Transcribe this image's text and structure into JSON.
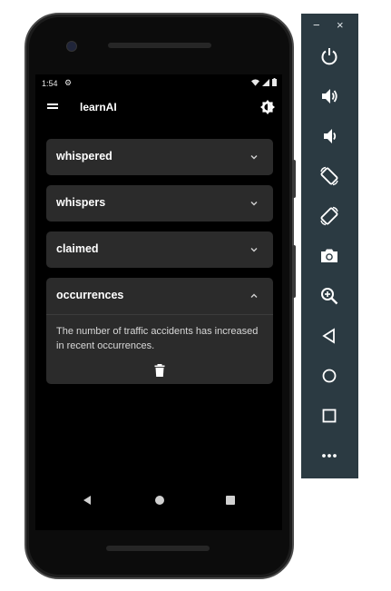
{
  "status": {
    "time": "1:54",
    "settings_icon": "gear-icon",
    "wifi_icon": "wifi-icon",
    "signal_icon": "signal-icon",
    "battery_icon": "battery-icon"
  },
  "appbar": {
    "title": "learnAI",
    "menu_icon": "menu-icon",
    "theme_icon": "brightness-icon"
  },
  "cards": [
    {
      "title": "whispered",
      "expanded": false
    },
    {
      "title": "whispers",
      "expanded": false
    },
    {
      "title": "claimed",
      "expanded": false
    },
    {
      "title": "occurrences",
      "expanded": true,
      "body": "The number of traffic accidents has increased in recent occurrences.",
      "delete_icon": "trash-icon"
    }
  ],
  "navbar": {
    "back_icon": "back-triangle-icon",
    "home_icon": "home-circle-icon",
    "recents_icon": "recents-square-icon"
  },
  "emulator_toolbar": {
    "minimize": "−",
    "close": "×",
    "buttons": [
      "power-icon",
      "volume-up-icon",
      "volume-down-icon",
      "rotate-left-icon",
      "rotate-right-icon",
      "camera-icon",
      "zoom-icon",
      "back-icon",
      "home-icon",
      "overview-icon",
      "more-icon"
    ]
  },
  "colors": {
    "screen_background": "#000000",
    "card_background": "#2b2b2b",
    "toolbar_background": "#2b3a42"
  }
}
